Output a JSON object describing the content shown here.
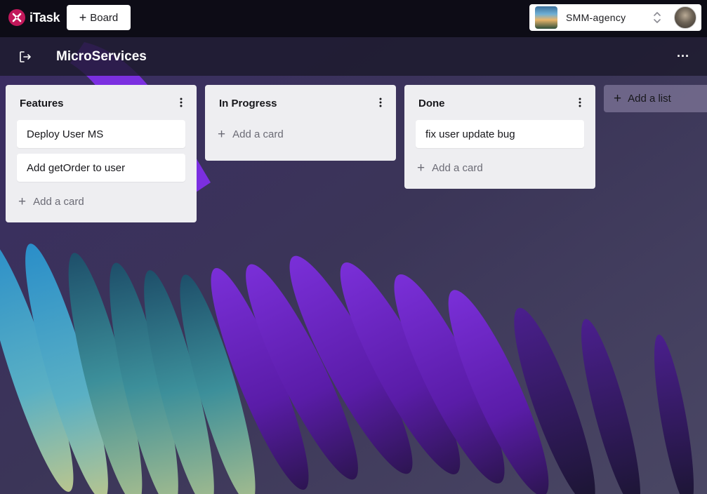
{
  "app": {
    "name": "iTask"
  },
  "toolbar": {
    "board_button_label": "Board"
  },
  "workspace": {
    "name": "SMM-agency"
  },
  "board": {
    "title": "MicroServices",
    "more_label": "···"
  },
  "lists": [
    {
      "title": "Features",
      "cards": [
        "Deploy User MS",
        "Add getOrder to user"
      ],
      "add_card_label": "Add a card"
    },
    {
      "title": "In Progress",
      "cards": [],
      "add_card_label": "Add a card"
    },
    {
      "title": "Done",
      "cards": [
        "fix user update bug"
      ],
      "add_card_label": "Add a card"
    }
  ],
  "add_list_label": "Add a list",
  "colors": {
    "topbar": "#0d0c16",
    "list_bg": "#eeeef1",
    "brand": "#c2185b",
    "add_list_bg": "#968caf"
  },
  "icons": {
    "logo": "itask-logo-icon",
    "plus": "plus-icon",
    "exit": "exit-board-icon",
    "menu": "kebab-menu-icon",
    "chevrons": "chevron-up-down-icon"
  }
}
